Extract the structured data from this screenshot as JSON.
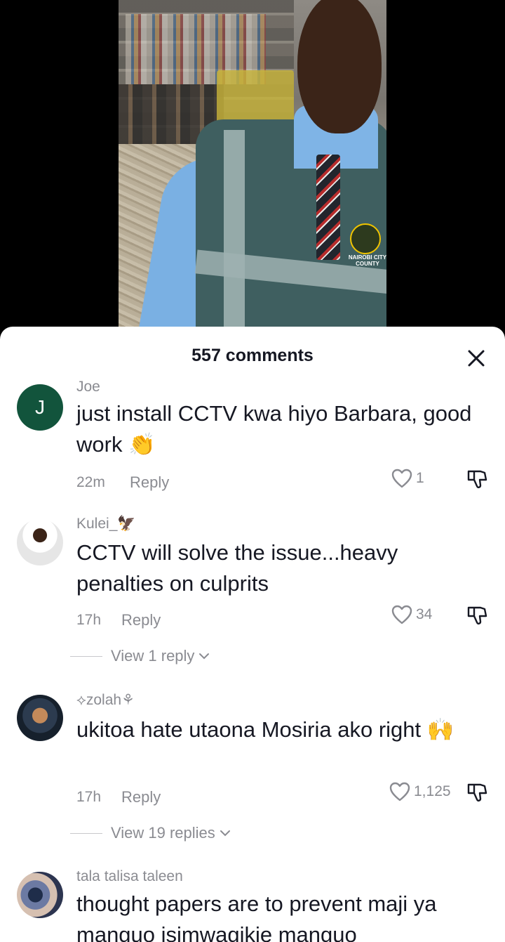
{
  "video": {
    "badge_text": "NAIROBI CITY COUNTY"
  },
  "sheet": {
    "title": "557 comments"
  },
  "comments": [
    {
      "username": "Joe",
      "avatar_letter": "J",
      "text": "just install CCTV kwa hiyo Barbara, good work 👏",
      "time": "22m",
      "reply_label": "Reply",
      "likes": "1",
      "view_replies": ""
    },
    {
      "username": "Kulei_🦅",
      "text": "CCTV will solve the issue...heavy penalties on culprits",
      "time": "17h",
      "reply_label": "Reply",
      "likes": "34",
      "view_replies": "View 1 reply"
    },
    {
      "username": "⟡zolah⚘",
      "text": "ukitoa hate utaona Mosiria ako right 🙌",
      "time": "17h",
      "reply_label": "Reply",
      "likes": "1,125",
      "view_replies": "View 19 replies"
    },
    {
      "username": "tala talisa taleen",
      "text": "thought papers are to prevent maji ya manguo isimwagikie manguo"
    }
  ],
  "icons": {
    "close": "close-icon",
    "like": "heart-outline-icon",
    "dislike": "thumbs-down-icon",
    "chevron": "chevron-down-icon"
  },
  "colors": {
    "text_primary": "#161823",
    "text_secondary": "#8a8b91",
    "avatar_j_bg": "#12543c",
    "sheet_bg": "#ffffff"
  }
}
